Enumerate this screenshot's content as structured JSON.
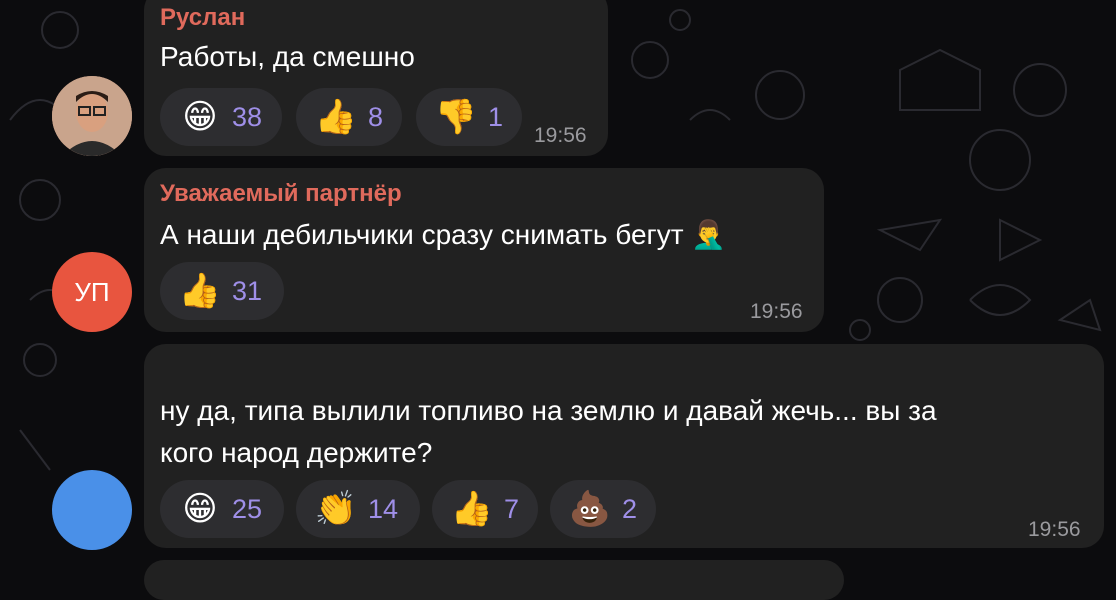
{
  "messages": [
    {
      "sender": "Руслан",
      "text": "Работы, да смешно",
      "time": "19:56",
      "avatar": {
        "type": "photo",
        "icon": "user-photo"
      },
      "reactions": [
        {
          "emoji": "😁",
          "icon": "grinning-face-icon",
          "count": "38"
        },
        {
          "emoji": "👍",
          "icon": "thumbs-up-icon",
          "count": "8"
        },
        {
          "emoji": "👎",
          "icon": "thumbs-down-icon",
          "count": "1"
        }
      ]
    },
    {
      "sender": "Уважаемый партнёр",
      "text": "А наши дебильчики сразу снимать бегут 🤦‍♂️",
      "time": "19:56",
      "avatar": {
        "type": "initials",
        "initials": "УП",
        "color": "#e8553f"
      },
      "reactions": [
        {
          "emoji": "👍",
          "icon": "thumbs-up-icon",
          "count": "31"
        }
      ]
    },
    {
      "sender": "",
      "text_lines": [
        "ну да, типа вылили топливо на землю и давай жечь... вы за",
        "кого народ держите?"
      ],
      "time": "19:56",
      "avatar": {
        "type": "color",
        "color": "#4a90e8"
      },
      "reactions": [
        {
          "emoji": "😁",
          "icon": "grinning-face-icon",
          "count": "25"
        },
        {
          "emoji": "👏",
          "icon": "clapping-hands-icon",
          "count": "14"
        },
        {
          "emoji": "👍",
          "icon": "thumbs-up-icon",
          "count": "7"
        },
        {
          "emoji": "💩",
          "icon": "pile-of-poo-icon",
          "count": "2"
        }
      ]
    }
  ],
  "colors": {
    "bubble": "#212121",
    "sender": "#e06a5c",
    "reaction_bg": "#2d2d30",
    "count": "#9f8fe8",
    "time": "#9a9a9e"
  }
}
